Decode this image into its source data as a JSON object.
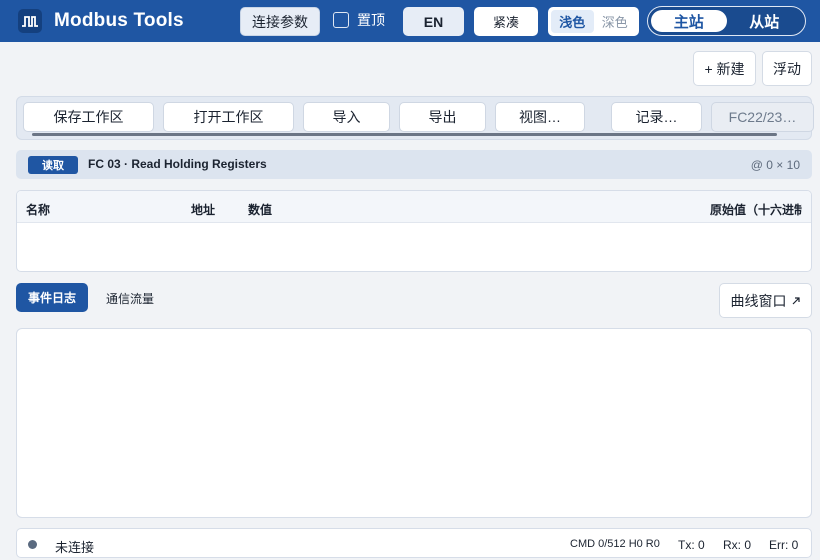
{
  "header": {
    "title": "Modbus Tools",
    "logo_icon": "waveform-icon",
    "conn_params": "连接参数",
    "pin_label": "置顶",
    "lang": "EN",
    "compact": "紧凑",
    "theme_light": "浅色",
    "theme_dark": "深色",
    "role_master": "主站",
    "role_slave": "从站",
    "accent": "#1f56a3"
  },
  "actions": {
    "new": "+ 新建",
    "float": "浮动"
  },
  "toolbar": {
    "save_ws": "保存工作区",
    "open_ws": "打开工作区",
    "import": "导入",
    "export": "导出",
    "view": "视图…",
    "record": "记录…",
    "fc22": "FC22/23…"
  },
  "read_panel": {
    "badge": "读取",
    "title": "FC 03 · Read Holding Registers",
    "meta": "@ 0 × 10"
  },
  "table": {
    "columns": [
      "名称",
      "地址",
      "数值",
      "原始值（十六进制）"
    ]
  },
  "log": {
    "tab_events": "事件日志",
    "tab_traffic": "通信流量",
    "curve_btn": "曲线窗口",
    "curve_icon": "external-link-icon"
  },
  "status": {
    "conn": "未连接",
    "cmd": "CMD 0/512 H0 R0",
    "tx": "Tx: 0",
    "rx": "Rx: 0",
    "err": "Err: 0"
  }
}
